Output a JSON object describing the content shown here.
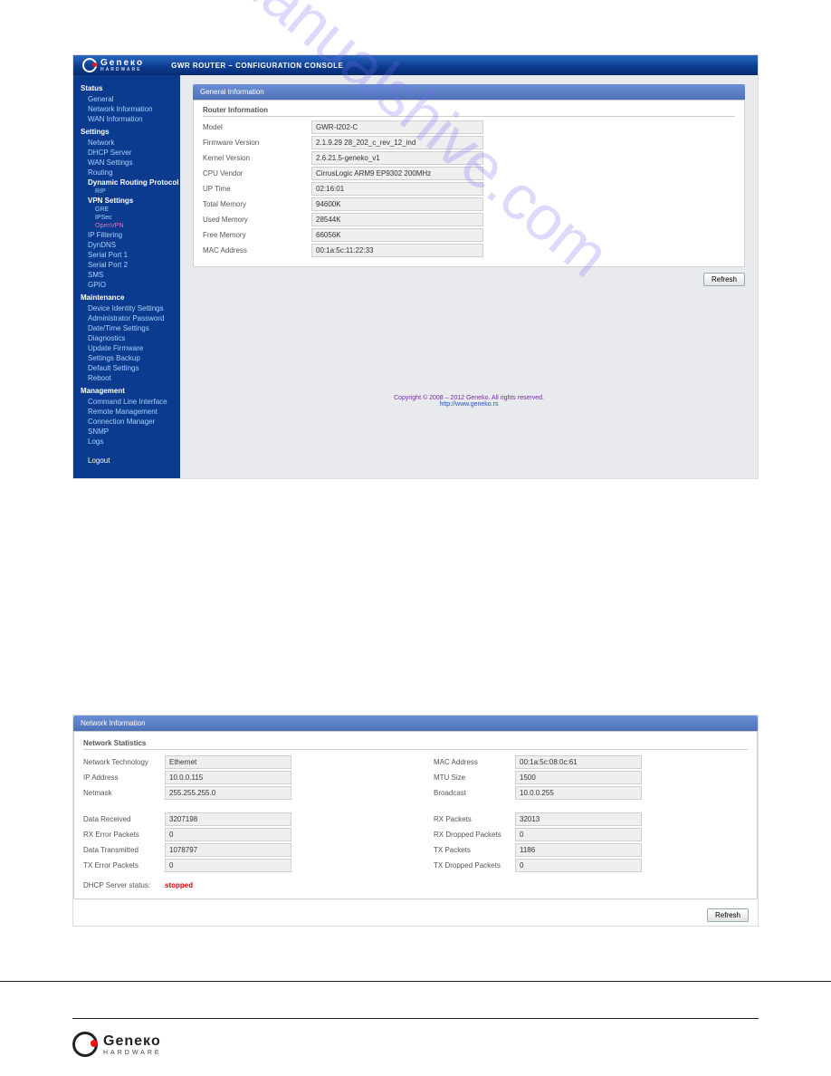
{
  "brand": {
    "name": "Geneкo",
    "sub": "HARDWARE"
  },
  "header": {
    "title": "GWR ROUTER – CONFIGURATION CONSOLE"
  },
  "sidebar": {
    "status": {
      "heading": "Status",
      "items": [
        "General",
        "Network Information",
        "WAN Information"
      ]
    },
    "settings": {
      "heading": "Settings",
      "items": [
        "Network",
        "DHCP Server",
        "WAN Settings",
        "Routing"
      ],
      "drp": {
        "label": "Dynamic Routing Protocol",
        "items": [
          "RIP"
        ]
      },
      "vpn": {
        "label": "VPN Settings",
        "items": [
          "GRE",
          "IPSec",
          "OpenVPN"
        ]
      },
      "rest": [
        "IP Filtering",
        "DynDNS",
        "Serial Port 1",
        "Serial Port 2",
        "SMS",
        "GPIO"
      ]
    },
    "maintenance": {
      "heading": "Maintenance",
      "items": [
        "Device Identity Settings",
        "Administrator Password",
        "Date/Time Settings",
        "Diagnostics",
        "Update Firmware",
        "Settings Backup",
        "Default Settings",
        "Reboot"
      ]
    },
    "management": {
      "heading": "Management",
      "items": [
        "Command Line Interface",
        "Remote Management",
        "Connection Manager",
        "SNMP",
        "Logs"
      ]
    },
    "logout": "Logout"
  },
  "gen": {
    "panel_title": "General Information",
    "sub_title": "Router Information",
    "rows": {
      "model": {
        "k": "Model",
        "v": "GWR-I202-C"
      },
      "fw": {
        "k": "Firmware Version",
        "v": "2.1.9.29 28_202_c_rev_12_ind"
      },
      "kernel": {
        "k": "Kernel Version",
        "v": "2.6.21.5-geneko_v1"
      },
      "cpu": {
        "k": "CPU Vendor",
        "v": "CirrusLogic ARM9 EP9302 200MHz"
      },
      "uptime": {
        "k": "UP Time",
        "v": "02:16:01"
      },
      "tmem": {
        "k": "Total Memory",
        "v": "94600K"
      },
      "umem": {
        "k": "Used Memory",
        "v": "28544K"
      },
      "fmem": {
        "k": "Free Memory",
        "v": "66056K"
      },
      "mac": {
        "k": "MAC Address",
        "v": "00:1a:5c:11:22:33"
      }
    },
    "refresh": "Refresh",
    "copyright": "Copyright © 2008 – 2012 Geneko. All rights reserved.",
    "link": "http://www.geneko.rs"
  },
  "watermark": "manualshive.com",
  "net": {
    "panel_title": "Network Information",
    "sub_title": "Network Statistics",
    "left1": {
      "tech": {
        "k": "Network Technology",
        "v": "Ethernet"
      },
      "ip": {
        "k": "IP Address",
        "v": "10.0.0.115"
      },
      "mask": {
        "k": "Netmask",
        "v": "255.255.255.0"
      }
    },
    "right1": {
      "mac": {
        "k": "MAC Address",
        "v": "00:1a:5c:08:0c:61"
      },
      "mtu": {
        "k": "MTU Size",
        "v": "1500"
      },
      "bc": {
        "k": "Broadcast",
        "v": "10.0.0.255"
      }
    },
    "left2": {
      "drx": {
        "k": "Data Received",
        "v": "3207198"
      },
      "rxe": {
        "k": "RX Error Packets",
        "v": "0"
      },
      "dtx": {
        "k": "Data Transmitted",
        "v": "1078797"
      },
      "txe": {
        "k": "TX Error Packets",
        "v": "0"
      }
    },
    "right2": {
      "rxp": {
        "k": "RX Packets",
        "v": "32013"
      },
      "rxd": {
        "k": "RX Dropped Packets",
        "v": "0"
      },
      "txp": {
        "k": "TX Packets",
        "v": "1186"
      },
      "txd": {
        "k": "TX Dropped Packets",
        "v": "0"
      }
    },
    "dhcp": {
      "k": "DHCP Server status:",
      "v": "stopped"
    },
    "refresh": "Refresh"
  }
}
